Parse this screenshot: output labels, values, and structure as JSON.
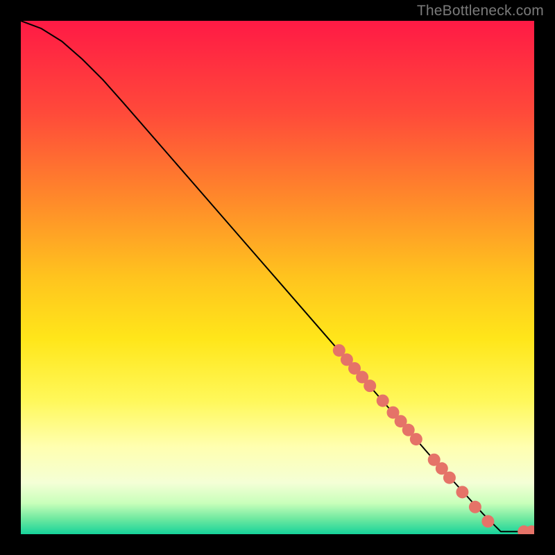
{
  "watermark": "TheBottleneck.com",
  "chart_data": {
    "type": "line",
    "title": "",
    "xlabel": "",
    "ylabel": "",
    "xlim": [
      0,
      100
    ],
    "ylim": [
      0,
      100
    ],
    "grid": false,
    "legend": false,
    "background_gradient_stops": [
      {
        "offset": 0.0,
        "color": "#ff1a45"
      },
      {
        "offset": 0.18,
        "color": "#ff4a3a"
      },
      {
        "offset": 0.35,
        "color": "#ff8a2a"
      },
      {
        "offset": 0.5,
        "color": "#ffc41e"
      },
      {
        "offset": 0.62,
        "color": "#ffe61a"
      },
      {
        "offset": 0.74,
        "color": "#fff85a"
      },
      {
        "offset": 0.83,
        "color": "#ffffb0"
      },
      {
        "offset": 0.9,
        "color": "#f4ffd6"
      },
      {
        "offset": 0.94,
        "color": "#c8ffba"
      },
      {
        "offset": 0.97,
        "color": "#6fe9a0"
      },
      {
        "offset": 1.0,
        "color": "#16d29a"
      }
    ],
    "series": [
      {
        "name": "curve",
        "color": "#000000",
        "stroke_width": 2,
        "points": [
          {
            "x": 0.0,
            "y": 100.0
          },
          {
            "x": 4.0,
            "y": 98.5
          },
          {
            "x": 8.0,
            "y": 96.0
          },
          {
            "x": 12.0,
            "y": 92.5
          },
          {
            "x": 16.0,
            "y": 88.5
          },
          {
            "x": 20.0,
            "y": 84.0
          },
          {
            "x": 30.0,
            "y": 72.5
          },
          {
            "x": 40.0,
            "y": 61.0
          },
          {
            "x": 50.0,
            "y": 49.5
          },
          {
            "x": 60.0,
            "y": 38.0
          },
          {
            "x": 70.0,
            "y": 26.5
          },
          {
            "x": 80.0,
            "y": 15.0
          },
          {
            "x": 90.0,
            "y": 4.0
          },
          {
            "x": 93.5,
            "y": 0.5
          },
          {
            "x": 96.0,
            "y": 0.5
          },
          {
            "x": 100.0,
            "y": 0.5
          }
        ]
      }
    ],
    "markers": {
      "name": "highlight-dots",
      "color": "#e57368",
      "radius": 9,
      "points": [
        {
          "x": 62.0,
          "y": 35.8
        },
        {
          "x": 63.5,
          "y": 34.0
        },
        {
          "x": 65.0,
          "y": 32.3
        },
        {
          "x": 66.5,
          "y": 30.6
        },
        {
          "x": 68.0,
          "y": 28.9
        },
        {
          "x": 70.5,
          "y": 26.0
        },
        {
          "x": 72.5,
          "y": 23.7
        },
        {
          "x": 74.0,
          "y": 22.0
        },
        {
          "x": 75.5,
          "y": 20.3
        },
        {
          "x": 77.0,
          "y": 18.5
        },
        {
          "x": 80.5,
          "y": 14.5
        },
        {
          "x": 82.0,
          "y": 12.8
        },
        {
          "x": 83.5,
          "y": 11.0
        },
        {
          "x": 86.0,
          "y": 8.2
        },
        {
          "x": 88.5,
          "y": 5.3
        },
        {
          "x": 91.0,
          "y": 2.5
        },
        {
          "x": 98.0,
          "y": 0.5
        },
        {
          "x": 99.5,
          "y": 0.5
        }
      ]
    }
  }
}
